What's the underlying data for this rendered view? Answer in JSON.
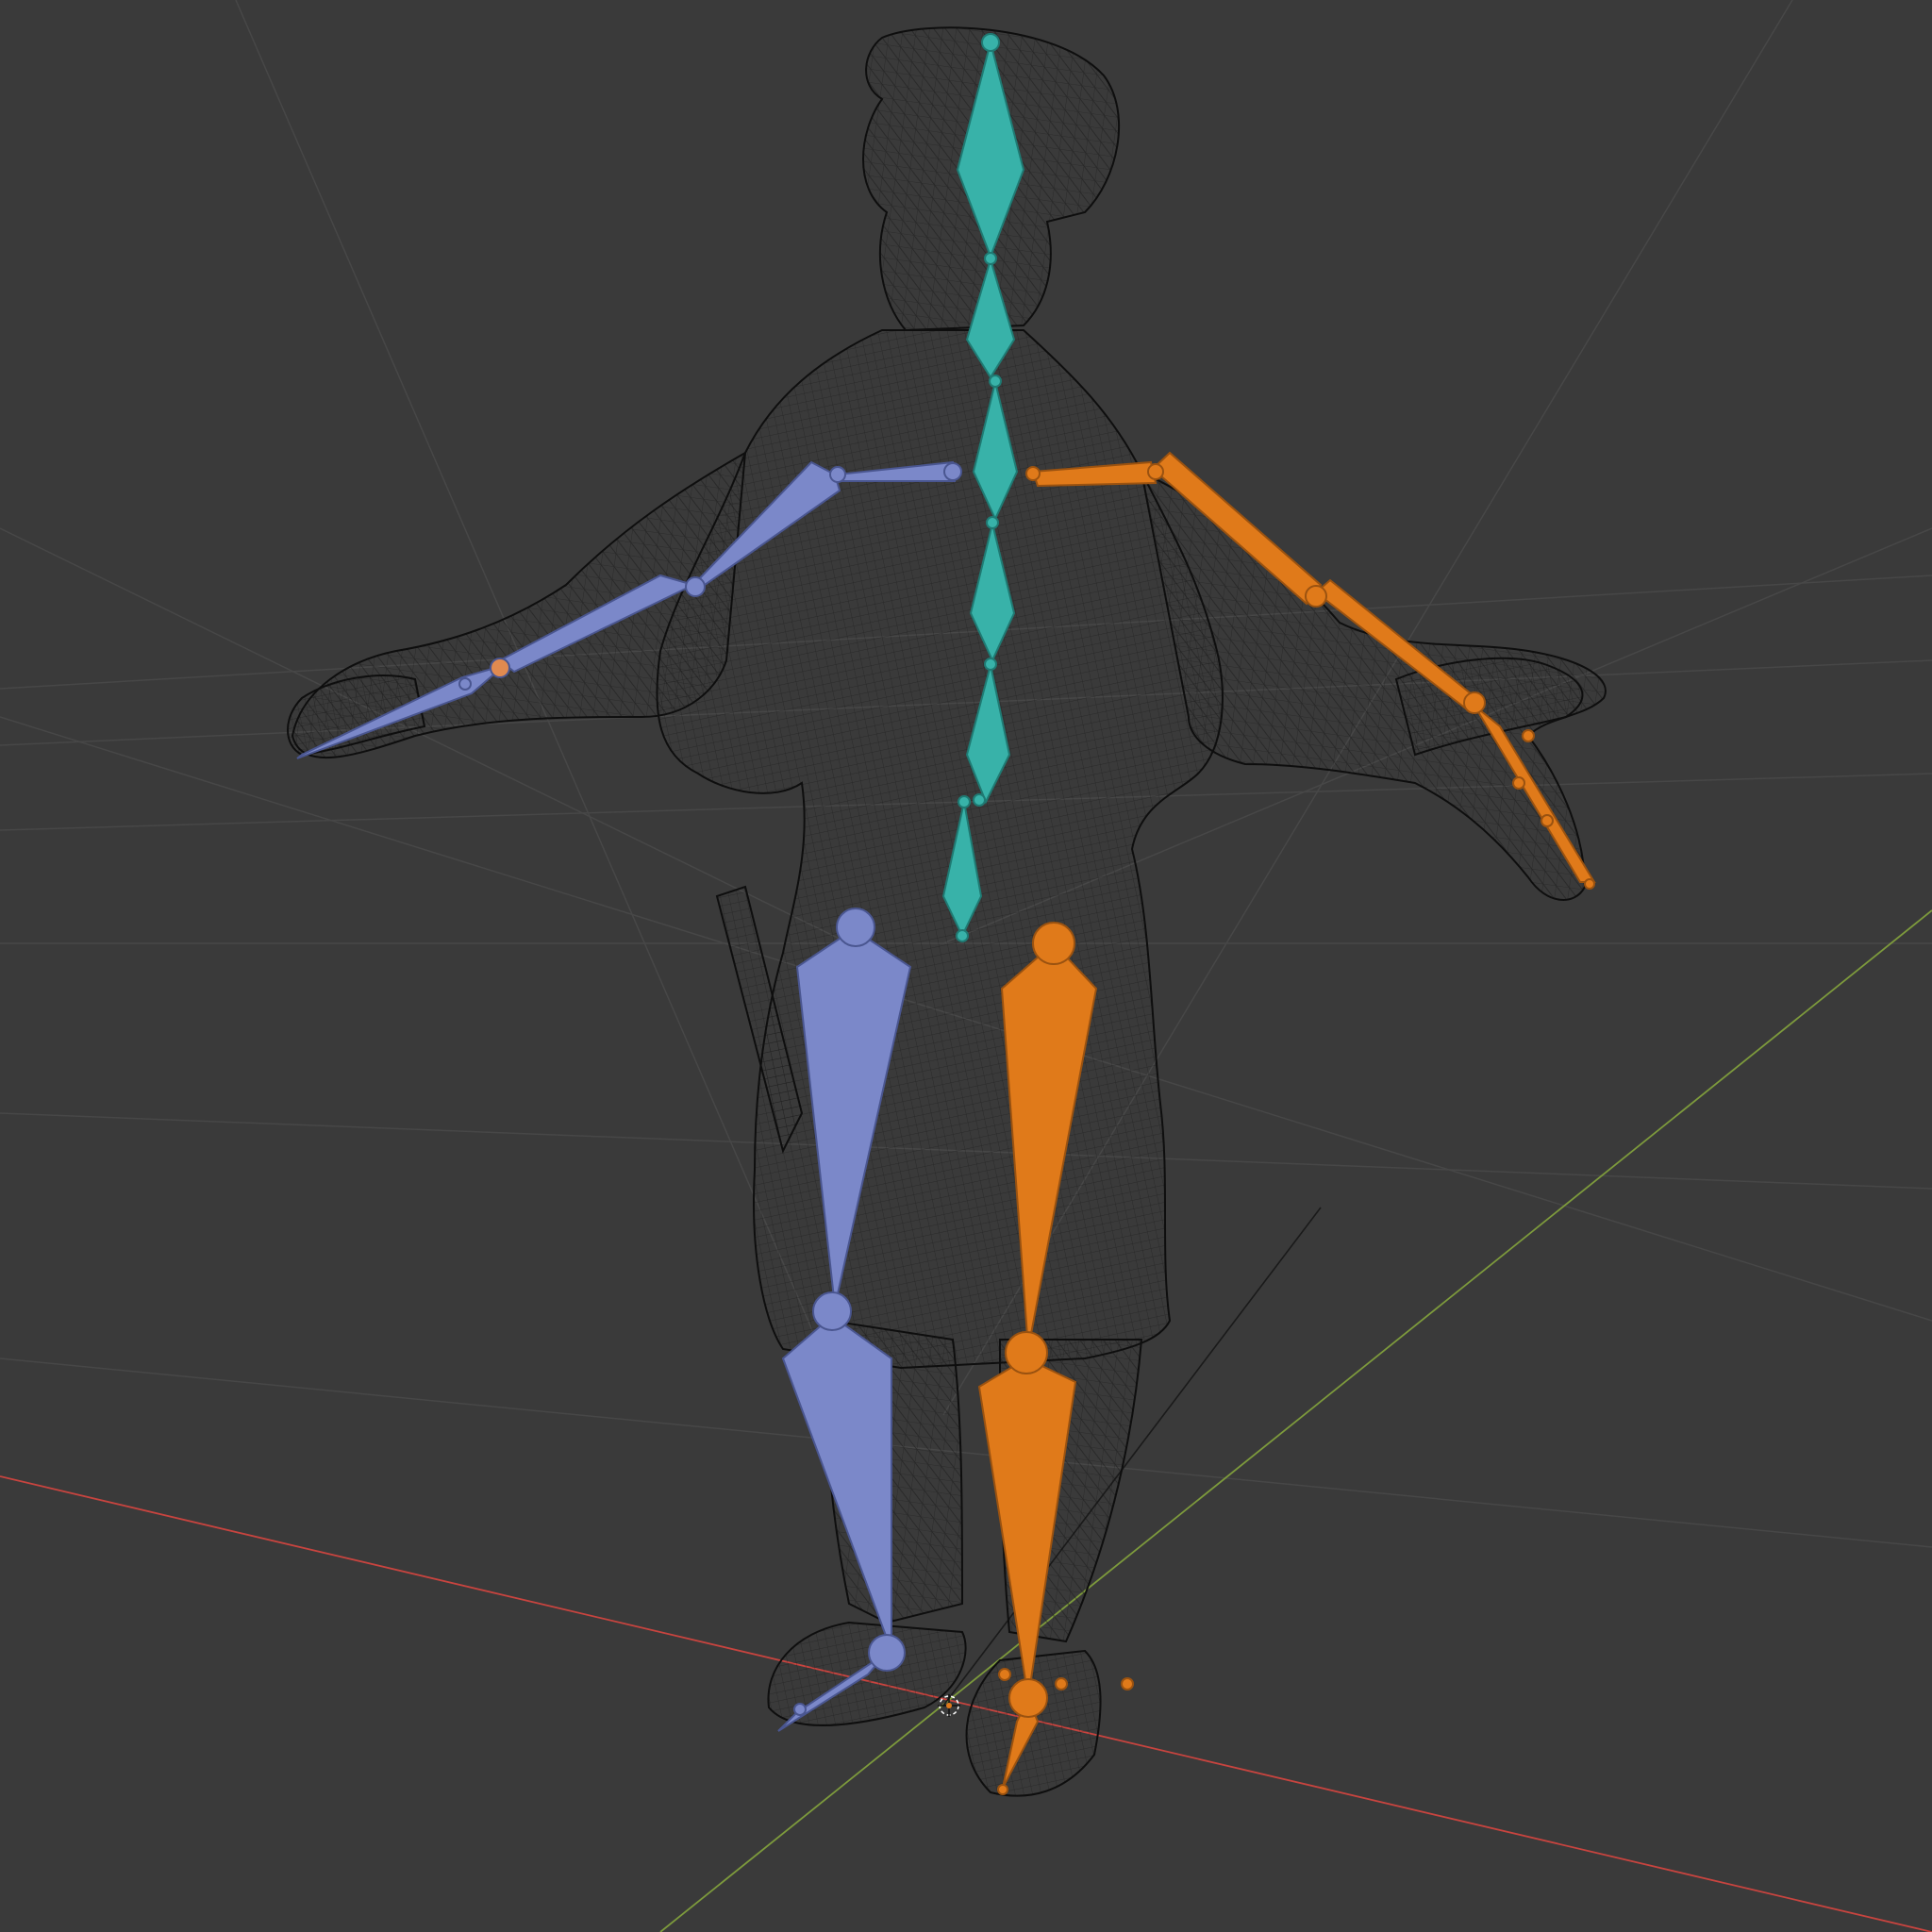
{
  "viewport": {
    "background_color": "#3a3a3a",
    "grid_color": "#4a4a4a",
    "x_axis_color": "#c8443f",
    "y_axis_color": "#7d9a3c",
    "wireframe_color": "#111111"
  },
  "armature": {
    "spine_color": "#38b2a9",
    "left_side_color": "#7b88c9",
    "right_side_color": "#e07a1a",
    "joint_color": "#5b6aa8"
  },
  "icons": {
    "origin": "origin-cursor-icon"
  }
}
